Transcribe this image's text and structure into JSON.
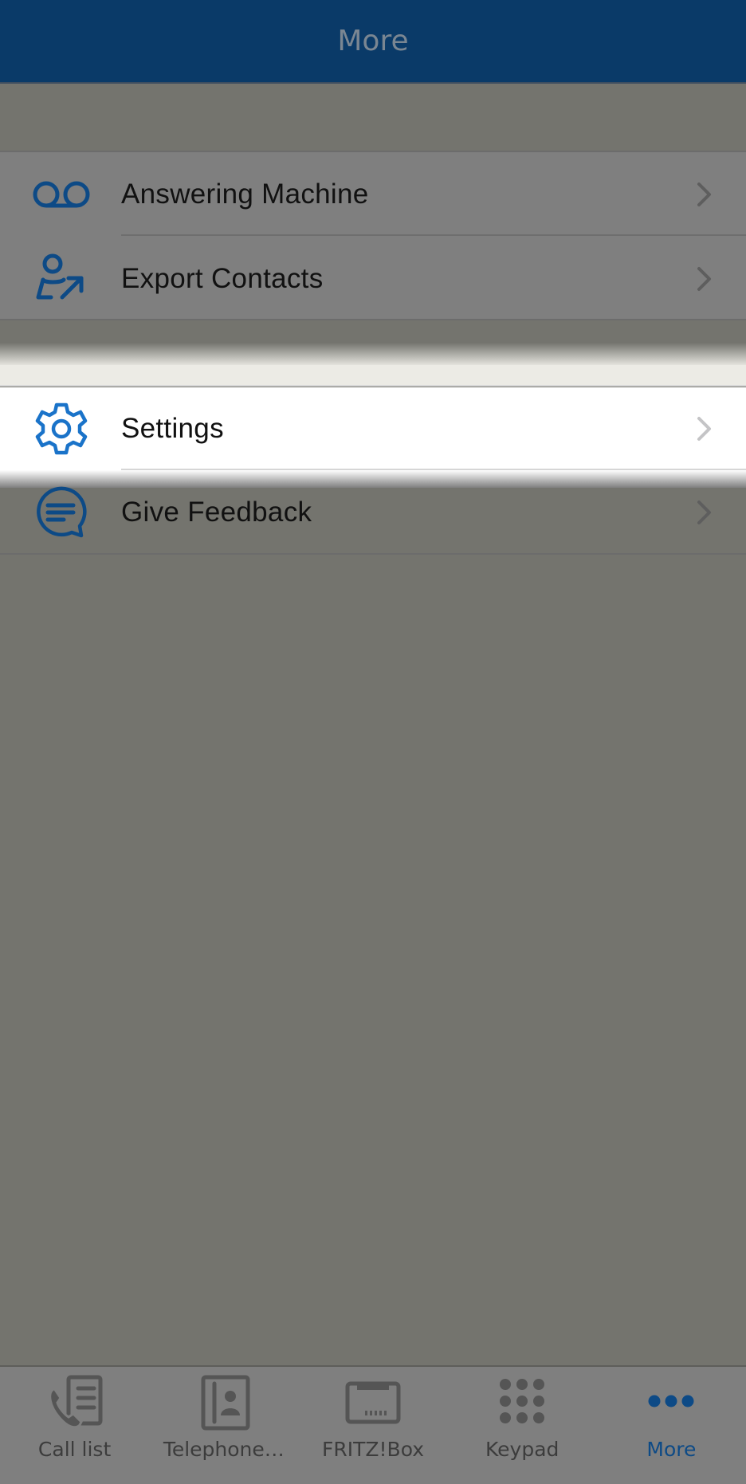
{
  "header": {
    "title": "More"
  },
  "menu": {
    "group1": [
      {
        "label": "Answering Machine",
        "icon": "voicemail-icon"
      },
      {
        "label": "Export Contacts",
        "icon": "export-contact-icon"
      }
    ],
    "highlighted": {
      "label": "Settings",
      "icon": "gear-icon"
    },
    "group2": [
      {
        "label": "Give Feedback",
        "icon": "feedback-icon"
      }
    ]
  },
  "tabs": [
    {
      "label": "Call list",
      "icon": "call-list-icon",
      "active": false
    },
    {
      "label": "Telephone…",
      "icon": "phonebook-icon",
      "active": false
    },
    {
      "label": "FRITZ!Box",
      "icon": "fritzbox-icon",
      "active": false
    },
    {
      "label": "Keypad",
      "icon": "keypad-icon",
      "active": false
    },
    {
      "label": "More",
      "icon": "more-dots-icon",
      "active": true
    }
  ],
  "colors": {
    "brand": "#0a3a68",
    "icon_dimmed": "#0d4a86",
    "icon_active": "#1a73c9",
    "tab_active": "#0d4a86"
  }
}
